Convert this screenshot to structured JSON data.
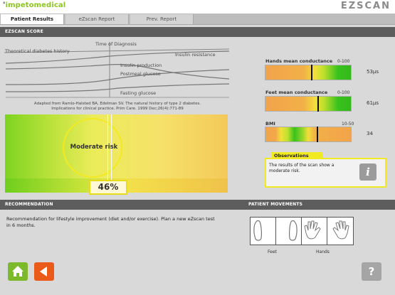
{
  "header": {
    "logo_text": "impetomedical",
    "brand_text": "EZSCAN",
    "brand_accent_color": "#7ab317"
  },
  "tabs": [
    {
      "label": "Patient Results",
      "active": true
    },
    {
      "label": "eZscan Report",
      "active": false
    },
    {
      "label": "Prev. Report",
      "active": false
    }
  ],
  "sections": {
    "score_title": "EZSCAN SCORE",
    "recommendation_title": "RECOMMENDATION",
    "movements_title": "PATIENT MOVEMENTS"
  },
  "history": {
    "time_of_diagnosis": "Time of Diagnosis",
    "theoretical": "Theoretical diabetes history",
    "insulin_resistance": "Insulin resistance",
    "insulin_production": "Insulin production",
    "postmeal_glucose": "Postmeal glucose",
    "fasting_glucose": "Fasting glucose",
    "reference": "Adapted from Ramlo-Halsted BA, Edelman SV. The natural history of type 2 diabetes. Implications for clinical practice. Prim Care. 1999 Dec;26(4):771-89"
  },
  "risk": {
    "label": "Moderate risk",
    "percent_text": "46%",
    "percent_value": 46
  },
  "meters": [
    {
      "label": "Hands mean conductance",
      "range": "0-100",
      "value_text": "53µs",
      "marker_fraction": 0.53
    },
    {
      "label": "Feet mean conductance",
      "range": "0-100",
      "value_text": "61µs",
      "marker_fraction": 0.61
    },
    {
      "label": "BMI",
      "range": "10-50",
      "value_text": "34",
      "marker_fraction": 0.6
    }
  ],
  "observations": {
    "title": "Observations",
    "text": "The results of the scan show a moderate risk.",
    "info_icon": "info-icon"
  },
  "recommendation": {
    "text": "Recommendation for lifestyle improvement (diet and/or exercise). Plan a new eZscan test in 6 months."
  },
  "movements": {
    "feet_label": "Feet",
    "hands_label": "Hands"
  },
  "nav": {
    "home_icon": "home-icon",
    "back_icon": "back-arrow-icon",
    "help_text": "?"
  }
}
